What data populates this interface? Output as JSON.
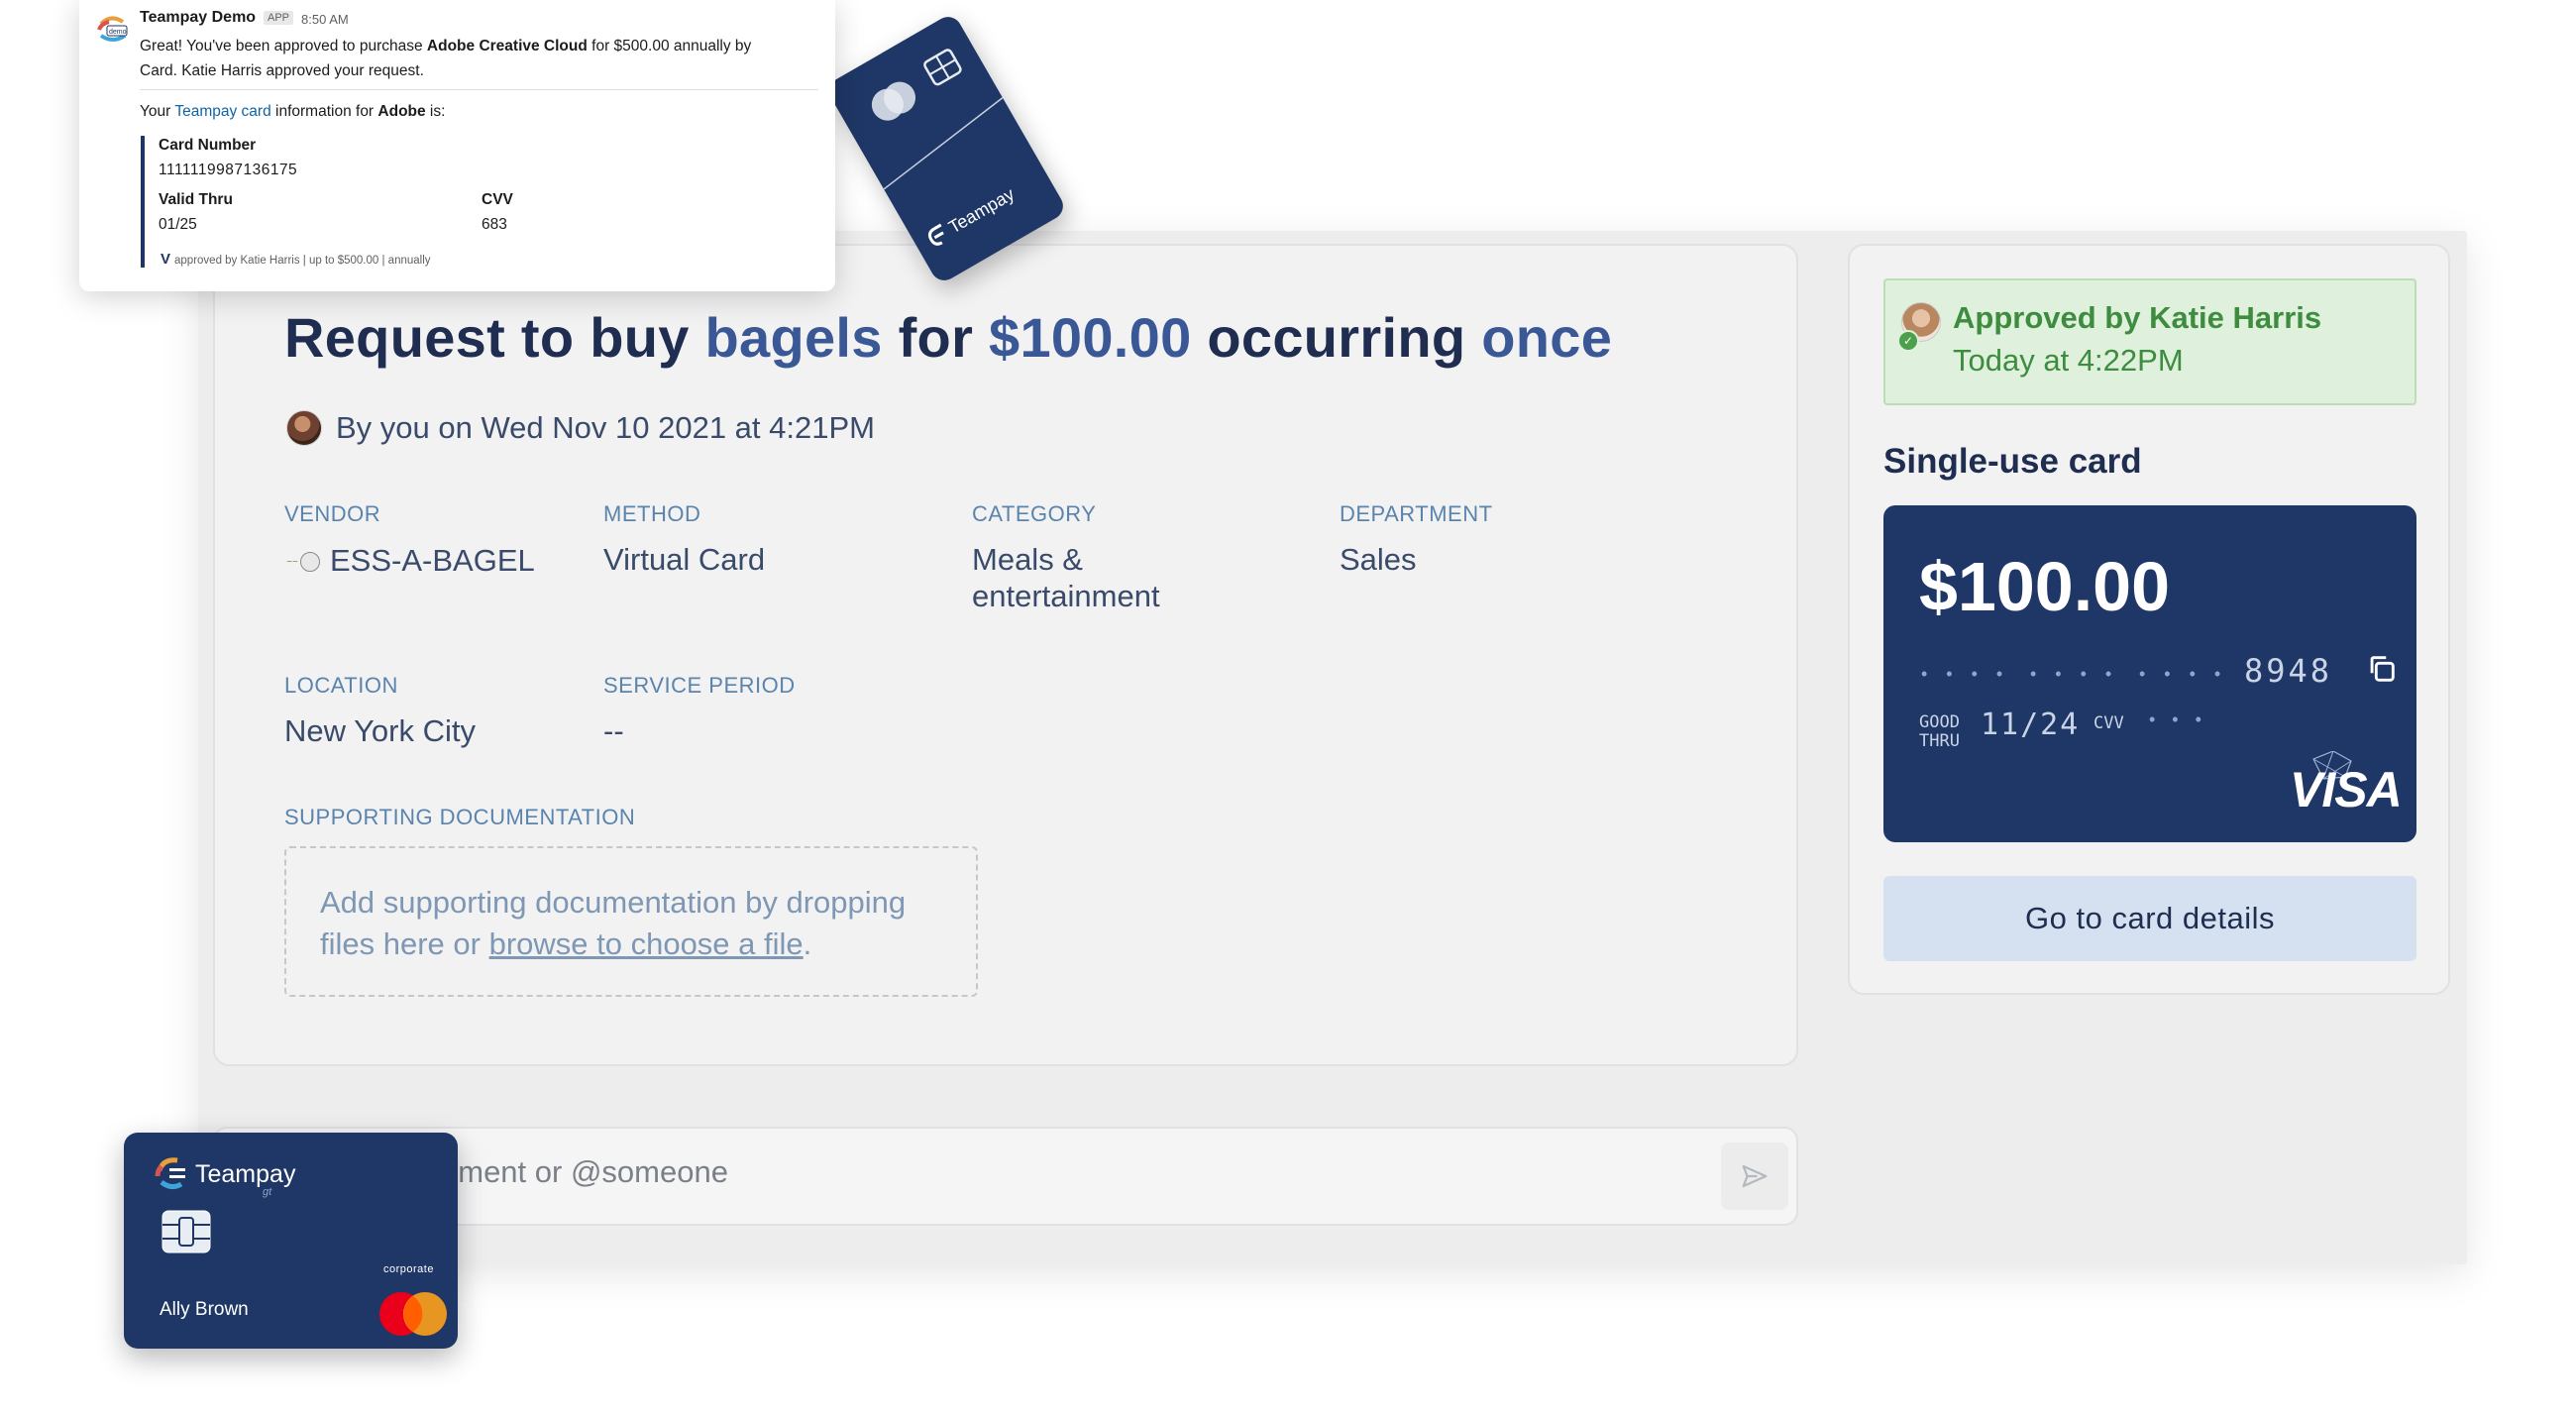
{
  "request": {
    "title_prefix": "Request to buy ",
    "item": "bagels",
    "title_for": " for ",
    "amount": "$100.00",
    "title_occurring": " occurring ",
    "frequency": "once",
    "byline": "By you on Wed Nov 10 2021 at 4:21PM",
    "fields": {
      "vendor_label": "VENDOR",
      "vendor_value": "ESS-A-BAGEL",
      "method_label": "METHOD",
      "method_value": "Virtual Card",
      "category_label": "CATEGORY",
      "category_line1": "Meals &",
      "category_line2": "entertainment",
      "department_label": "DEPARTMENT",
      "department_value": "Sales",
      "location_label": "LOCATION",
      "location_value": "New York City",
      "service_period_label": "SERVICE PERIOD",
      "service_period_value": "--",
      "supporting_doc_label": "SUPPORTING DOCUMENTATION"
    },
    "dropzone": {
      "text_line1": "Add supporting documentation by dropping",
      "text_line2_prefix": "files here or ",
      "link": "browse to choose a file",
      "text_line2_suffix": "."
    }
  },
  "comment": {
    "placeholder_visible": "nment or @someone",
    "send_icon": "send-icon"
  },
  "approval": {
    "title": "Approved by Katie Harris",
    "time": "Today at 4:22PM",
    "status_color": "#3e8c3f"
  },
  "single_use_card": {
    "heading": "Single-use card",
    "amount": "$100.00",
    "masked_groups": [
      "• • • •",
      "• • • •",
      "• • • •"
    ],
    "last4": "8948",
    "good_thru_line1": "GOOD",
    "good_thru_line2": "THRU",
    "expiry": "11/24",
    "cvv_label": "CVV",
    "cvv_masked": "• • •",
    "network": "VISA",
    "copy_icon": "copy-icon",
    "details_button": "Go to card details"
  },
  "slack": {
    "app_name": "Teampay Demo",
    "badge": "APP",
    "time": "8:50 AM",
    "message_line1_pre": "Great! You've been approved to purchase ",
    "message_product": "Adobe Creative Cloud",
    "message_line1_post": " for $500.00 annually by",
    "message_line2": "Card. Katie Harris approved your request.",
    "info_pre": "Your ",
    "info_link": "Teampay card",
    "info_mid": " information for ",
    "info_vendor": "Adobe",
    "info_post": " is:",
    "card_number_label": "Card Number",
    "card_number": "1111119987136175",
    "valid_thru_label": "Valid Thru",
    "valid_thru": "01/25",
    "cvv_label": "CVV",
    "cvv": "683",
    "footer_mark": "V",
    "footer": "approved by Katie Harris | up to $500.00 | annually",
    "logo_sub": "demo"
  },
  "tilted_card": {
    "brand": "Teampay"
  },
  "corporate_card": {
    "brand": "Teampay",
    "brand_sub": "gt",
    "label": "corporate",
    "holder": "Ally Brown"
  },
  "colors": {
    "navy": "#1f3766",
    "accent_blue": "#3b5896",
    "label_blue": "#5b84ad",
    "approval_green_bg": "#dff1dc",
    "button_blue": "#d5e1f0"
  }
}
